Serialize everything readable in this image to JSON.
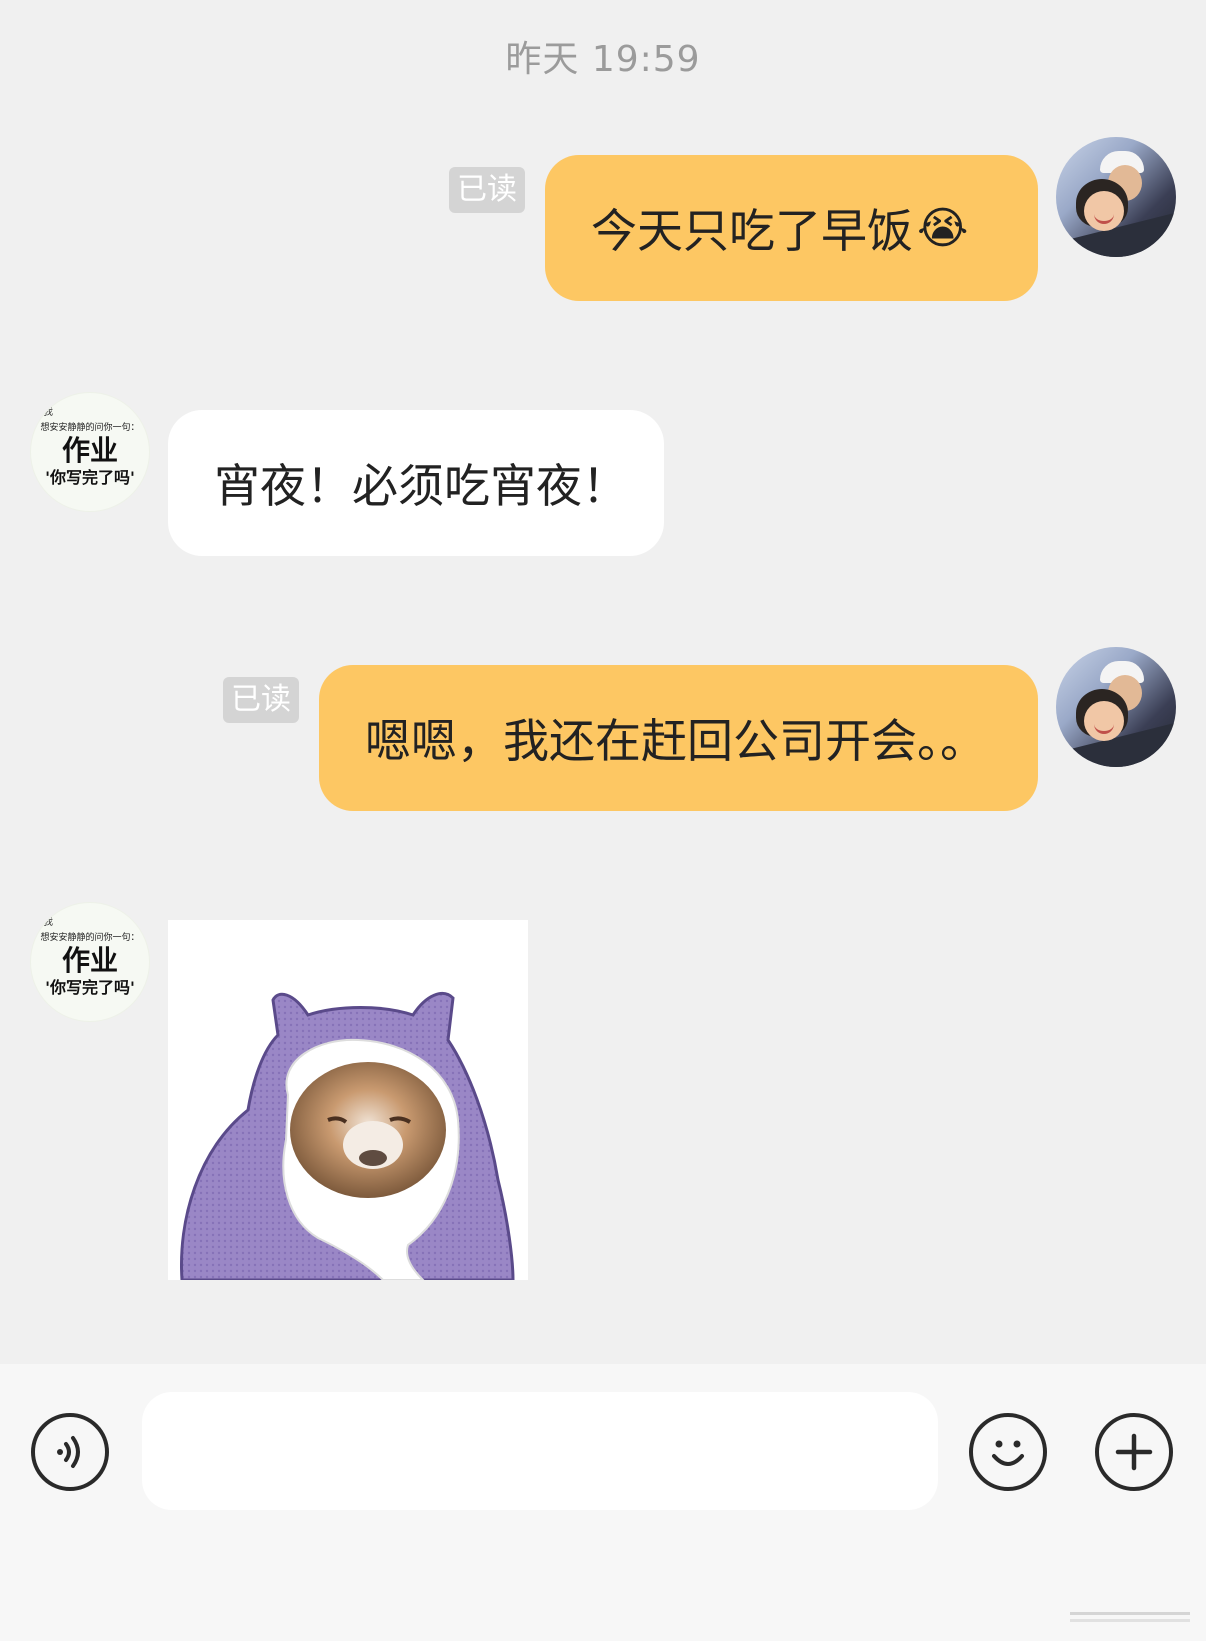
{
  "chat": {
    "timestamp": "昨天 19:59",
    "messages": [
      {
        "sender": "self",
        "text": "今天只吃了早饭",
        "emoji": "😭",
        "read_badge": "已读"
      },
      {
        "sender": "peer",
        "text": "宵夜！必须吃宵夜！"
      },
      {
        "sender": "self",
        "text": "嗯嗯，我还在赶回公司开会。。",
        "read_badge": "已读"
      },
      {
        "sender": "peer",
        "type": "sticker",
        "sticker": "purple-hooded-hamster-sticker"
      }
    ]
  },
  "peer_avatar": {
    "mark": "我",
    "line_top": "想安安静静的问你一句：",
    "line_big": "作业",
    "line_bottom": "'你写完了吗'"
  },
  "input_bar": {
    "voice_icon": "voice-icon",
    "emoji_icon": "smiley-icon",
    "plus_icon": "plus-icon",
    "placeholder": ""
  },
  "colors": {
    "background": "#f0f0f0",
    "self_bubble": "#fdc763",
    "peer_bubble": "#ffffff",
    "read_badge": "#d4d4d4",
    "timestamp": "#9b9b9b"
  }
}
